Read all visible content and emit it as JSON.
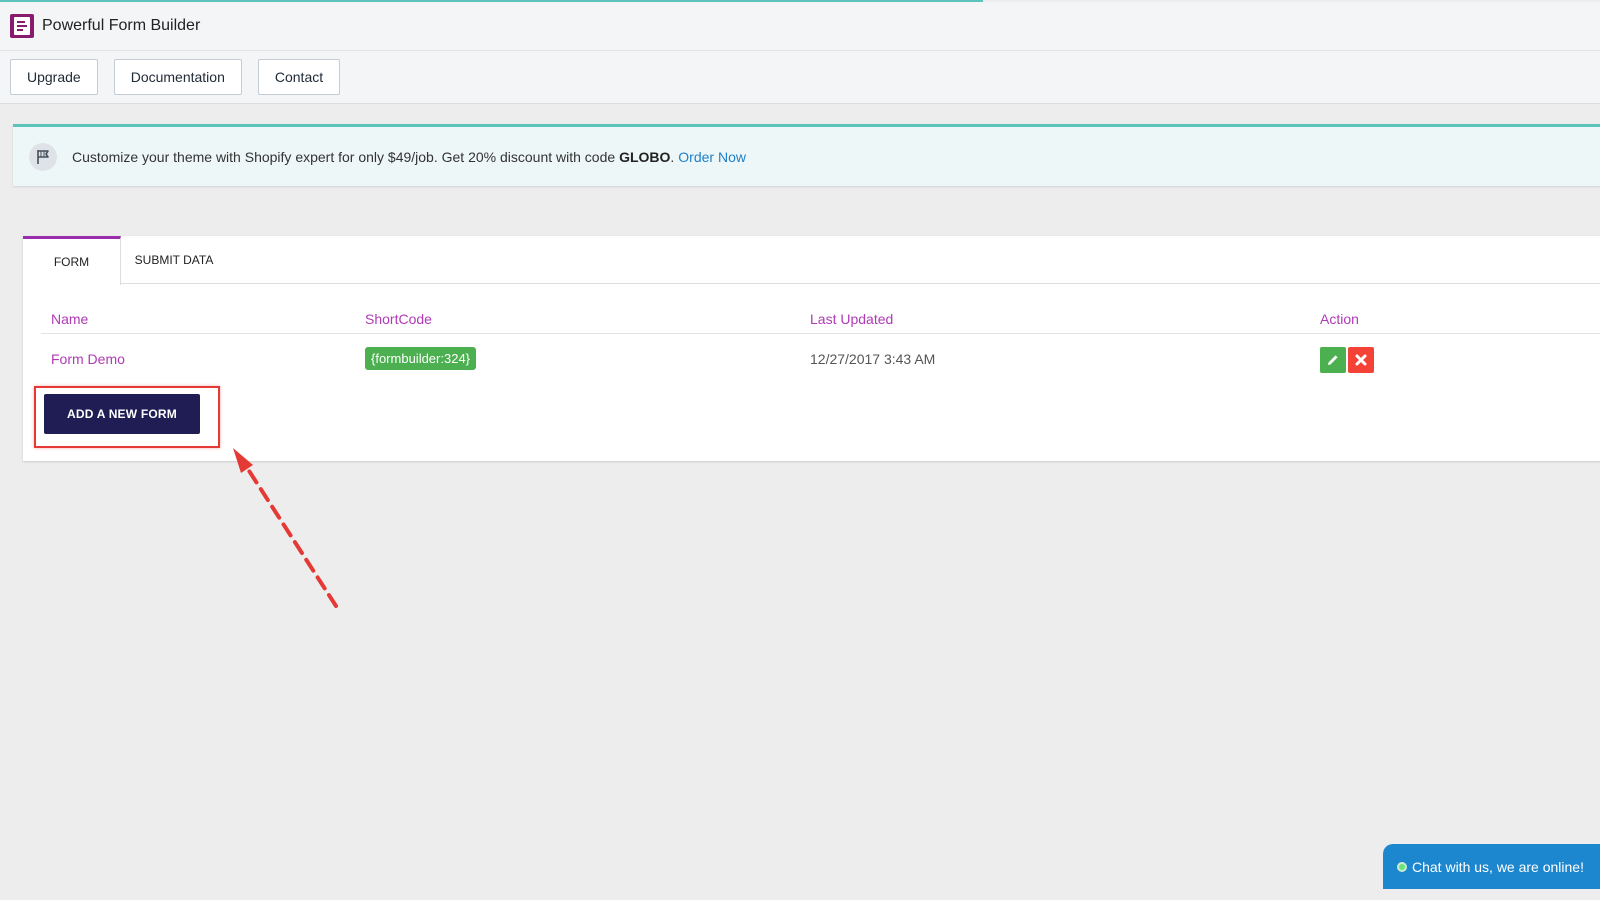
{
  "app": {
    "title": "Powerful Form Builder",
    "logo_icon": "form-builder-logo-icon"
  },
  "toolbar": {
    "upgrade_label": "Upgrade",
    "documentation_label": "Documentation",
    "contact_label": "Contact"
  },
  "banner": {
    "icon": "flag-icon",
    "text": "Customize your theme with Shopify expert for only $49/job. Get 20% discount with code ",
    "code": "GLOBO",
    "suffix": ".",
    "link_label": "Order Now"
  },
  "tabs": [
    {
      "label": "FORM",
      "active": true
    },
    {
      "label": "SUBMIT DATA",
      "active": false
    }
  ],
  "table": {
    "columns": [
      "Name",
      "ShortCode",
      "Last Updated",
      "Action"
    ],
    "rows": [
      {
        "name": "Form Demo",
        "shortcode": "{formbuilder:324}",
        "last_updated": "12/27/2017 3:43 AM",
        "actions": [
          "pencil-icon",
          "close-icon"
        ]
      }
    ]
  },
  "add_button_label": "ADD A NEW FORM",
  "chat": {
    "label": "Chat with us, we are online!",
    "status_color": "#6ee17b"
  },
  "colors": {
    "accent_purple": "#9c2fae",
    "teal": "#5bc3b9",
    "add_button": "#1f1d54",
    "edit_green": "#4caf50",
    "delete_red": "#f44336",
    "link_blue": "#1f7fc7"
  }
}
